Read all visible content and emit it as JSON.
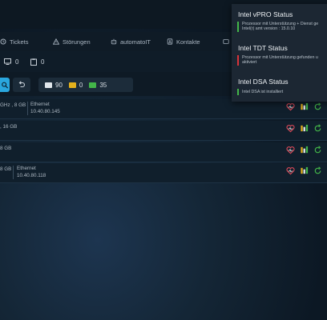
{
  "nav": {
    "items": [
      {
        "label": "Tickets",
        "icon": "ticket-icon"
      },
      {
        "label": "Störungen",
        "icon": "warning-icon"
      },
      {
        "label": "automatoIT",
        "icon": "robot-icon"
      },
      {
        "label": "Kontakte",
        "icon": "contact-icon"
      }
    ]
  },
  "counters": {
    "monitor": "0",
    "clipboard": "0"
  },
  "stats": {
    "desktops": "90",
    "warnings": "0",
    "ok": "35"
  },
  "rows": [
    {
      "cpu": "GHz , 8 GB",
      "net_label": "Ethernet",
      "ip": "10.40.80.145"
    },
    {
      "cpu": ", 16 GB",
      "net_label": "",
      "ip": ""
    },
    {
      "cpu": "8 GB",
      "net_label": "",
      "ip": ""
    },
    {
      "cpu": "8 GB",
      "net_label": "Ethernet",
      "ip": "10.40.80.118"
    }
  ],
  "notifications": [
    {
      "title": "Intel vPRO Status",
      "line1": "Prozessor mit Unterstützung + Dienst ge",
      "line2": "Intel(r) amt version : 15.0.10",
      "color": "#43b649"
    },
    {
      "title": "Intel TDT Status",
      "line1": "Prozessor mit Unterstützung gefunden u",
      "line2": "aktiviert",
      "color": "#d8333a"
    },
    {
      "title": "Intel DSA Status",
      "line1": "Intel DSA ist installiert",
      "line2": "",
      "color": "#43b649"
    }
  ],
  "colors": {
    "accent": "#2aa7de",
    "ok": "#43b649",
    "error": "#d8333a",
    "warn": "#e4b11c",
    "heart": "#e34b5a"
  }
}
